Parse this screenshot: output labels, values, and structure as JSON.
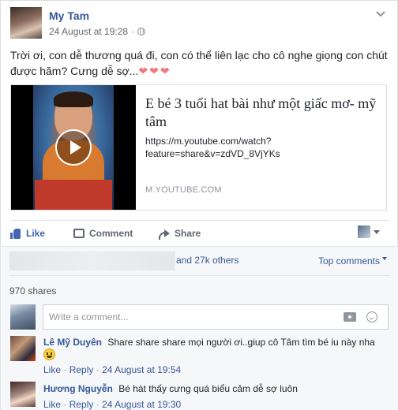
{
  "post": {
    "author": "My Tam",
    "timestamp": "24 August at 19:28",
    "separator": "·",
    "privacy_icon": "globe-icon",
    "text": "Trời ơi, con dễ thương quá đi, con có thể liên lạc cho cô nghe giọng con chút được hăm? Cưng dễ sợ...",
    "hearts": "❤❤❤"
  },
  "link_preview": {
    "title": "E bé 3 tuổi hat bài như một giấc mơ- mỹ tâm",
    "url": "https://m.youtube.com/watch?feature=share&v=zdVD_8VjYKs",
    "domain": "M.YOUTUBE.COM"
  },
  "actions": {
    "like": "Like",
    "comment": "Comment",
    "share": "Share"
  },
  "reactions": {
    "others": "and 27k others",
    "top_comments": "Top comments"
  },
  "shares": "970 shares",
  "comment_input": {
    "placeholder": "Write a comment..."
  },
  "comments": [
    {
      "name": "Lê Mỹ Duyên",
      "text": "Share share share mọi người ơi..giup cô Tâm tìm bé iu này nha",
      "like": "Like",
      "reply": "Reply",
      "time": "24 August at 19:54"
    },
    {
      "name": "Hương Nguyễn",
      "text": "Bé hát thấy cưng quá biểu cảm dễ sợ luôn",
      "like": "Like",
      "reply": "Reply",
      "time": "24 August at 19:30"
    }
  ],
  "colors": {
    "link_blue": "#365899",
    "like_blue": "#4267b2",
    "heart": "#f27b80",
    "gray_bg": "#f6f7f9"
  }
}
